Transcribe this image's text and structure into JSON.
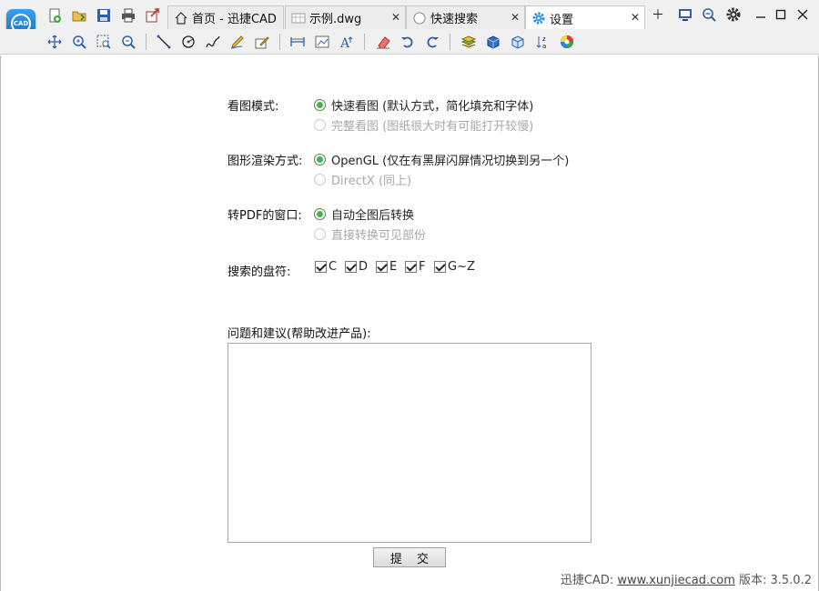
{
  "tabs": [
    {
      "label": "首页 - 迅捷CAD",
      "icon": "home-icon"
    },
    {
      "label": "示例.dwg",
      "icon": "drawing-file-icon"
    },
    {
      "label": "快速搜索",
      "icon": "search-circle-icon"
    },
    {
      "label": "设置",
      "icon": "gear-icon"
    }
  ],
  "settings": {
    "view_mode": {
      "label": "看图模式:",
      "options": [
        "快速看图 (默认方式，简化填充和字体)",
        "完整看图 (图纸很大时有可能打开较慢)"
      ]
    },
    "render_mode": {
      "label": "图形渲染方式:",
      "options": [
        "OpenGL (仅在有黑屏闪屏情况切换到另一个)",
        "DirectX (同上)"
      ]
    },
    "pdf_window": {
      "label": "转PDF的窗口:",
      "options": [
        "自动全图后转换",
        "直接转换可见部份"
      ]
    },
    "search_drives": {
      "label": "搜索的盘符:",
      "drives": [
        "C",
        "D",
        "E",
        "F",
        "G~Z"
      ]
    },
    "feedback": {
      "label": "问题和建议(帮助改进产品):",
      "value": ""
    },
    "submit_label": "提 交"
  },
  "footer": {
    "prefix": "迅捷CAD: ",
    "url": "www.xunjiecad.com",
    "version": " 版本: 3.5.0.2"
  },
  "colors": {
    "accent": "#1e88e5",
    "radio_selected": "#4caf50"
  }
}
